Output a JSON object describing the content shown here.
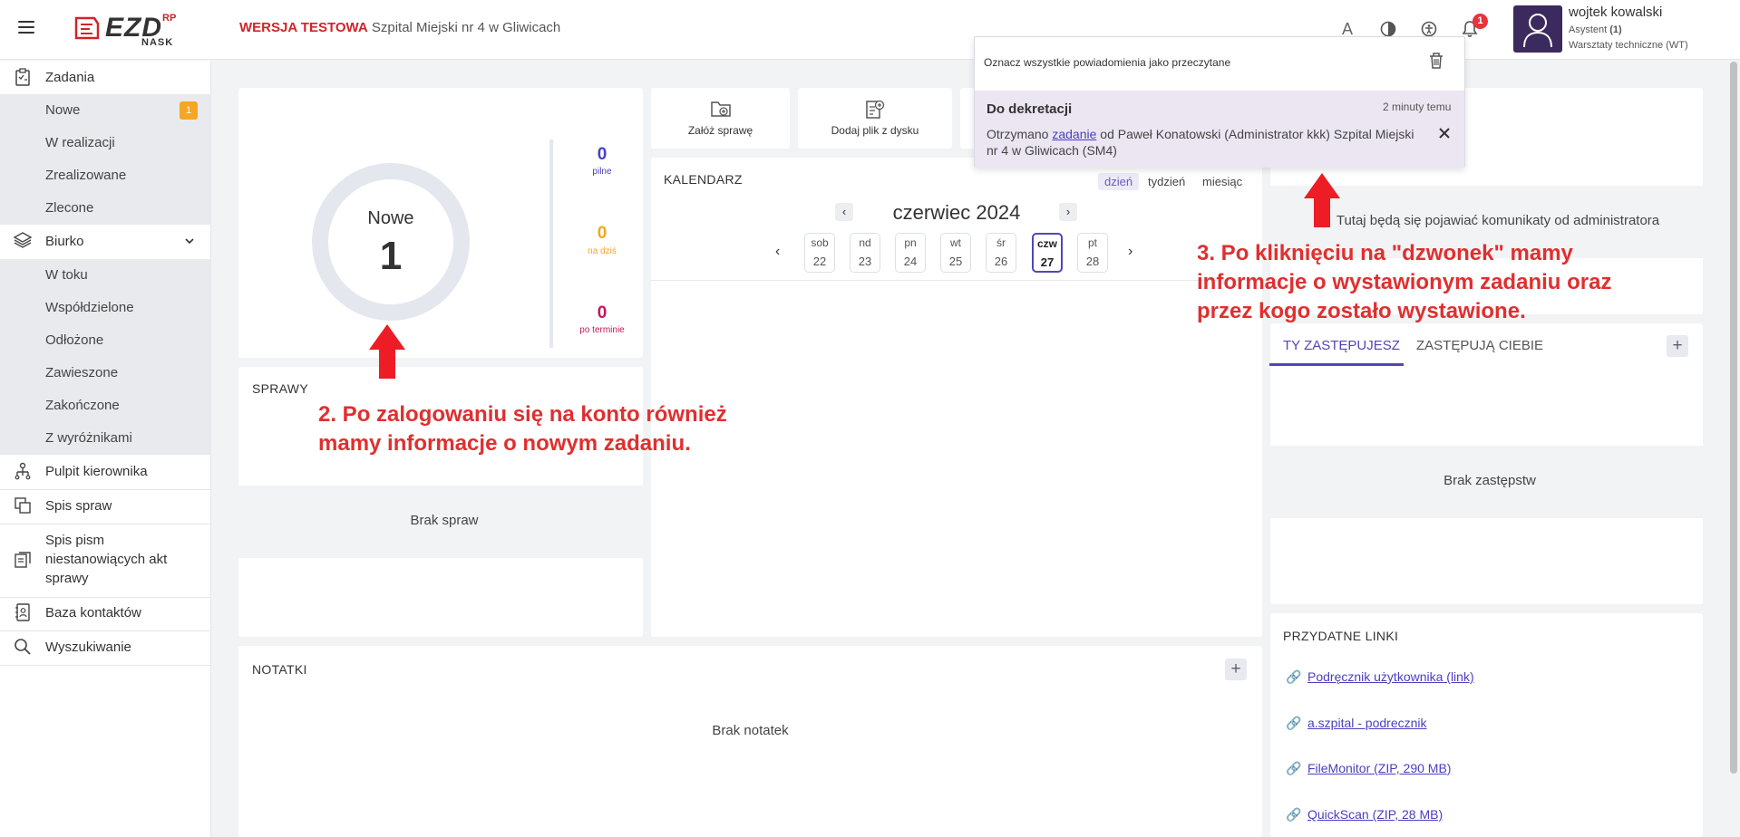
{
  "header": {
    "logo_text": "EZD",
    "logo_rp": "RP",
    "logo_nask": "NASK",
    "test_label": "WERSJA TESTOWA",
    "org_name": "Szpital Miejski nr 4 w Gliwicach",
    "notification_count": "1",
    "user": {
      "name": "wojtek kowalski",
      "role": "Asystent",
      "role_count": "(1)",
      "dept": "Warsztaty techniczne (WT)"
    },
    "icons": [
      "font-size-icon",
      "contrast-icon",
      "accessibility-icon",
      "bell-icon"
    ]
  },
  "sidebar": {
    "zadania": "Zadania",
    "zadania_items": [
      {
        "label": "Nowe",
        "badge": "1"
      },
      {
        "label": "W realizacji"
      },
      {
        "label": "Zrealizowane"
      },
      {
        "label": "Zlecone"
      }
    ],
    "biurko": "Biurko",
    "biurko_items": [
      {
        "label": "W toku"
      },
      {
        "label": "Współdzielone"
      },
      {
        "label": "Odłożone"
      },
      {
        "label": "Zawieszone"
      },
      {
        "label": "Zakończone"
      },
      {
        "label": "Z wyróżnikami"
      }
    ],
    "pulpit": "Pulpit kierownika",
    "spis_spraw": "Spis spraw",
    "spis_pism_1": "Spis pism",
    "spis_pism_2": "niestanowiących akt",
    "spis_pism_3": "sprawy",
    "baza": "Baza kontaktów",
    "wyszukiwanie": "Wyszukiwanie"
  },
  "tasks_widget": {
    "label": "Nowe",
    "count": "1",
    "pilne_count": "0",
    "pilne_label": "pilne",
    "dzis_count": "0",
    "dzis_label": "na dziś",
    "termin_count": "0",
    "termin_label": "po terminie",
    "colors": {
      "pilne": "#4a3fc2",
      "dzis": "#f5a623",
      "termin": "#c2185b"
    }
  },
  "quick_actions": {
    "zaloz": "Załóż sprawę",
    "dodaj": "Dodaj plik z dysku"
  },
  "calendar": {
    "title": "KALENDARZ",
    "views": [
      "dzień",
      "tydzień",
      "miesiąc"
    ],
    "active_view": "dzień",
    "month": "czerwiec 2024",
    "days": [
      {
        "name": "sob",
        "date": "22"
      },
      {
        "name": "nd",
        "date": "23"
      },
      {
        "name": "pn",
        "date": "24"
      },
      {
        "name": "wt",
        "date": "25"
      },
      {
        "name": "śr",
        "date": "26"
      },
      {
        "name": "czw",
        "date": "27",
        "today": true
      },
      {
        "name": "pt",
        "date": "28"
      }
    ]
  },
  "sprawy": {
    "title": "SPRAWY",
    "empty": "Brak spraw"
  },
  "notatki": {
    "title": "NOTATKI",
    "empty": "Brak notatek"
  },
  "admin": {
    "message": "Tutaj będą się pojawiać komunikaty od administratora"
  },
  "substitutes": {
    "tab_1": "TY ZASTĘPUJESZ",
    "tab_2": "ZASTĘPUJĄ CIEBIE",
    "empty": "Brak zastępstw"
  },
  "links": {
    "title": "PRZYDATNE LINKI",
    "items": [
      "Podręcznik użytkownika (link)",
      "a.szpital - podrecznik",
      "FileMonitor (ZIP, 290 MB)",
      "QuickScan (ZIP, 28 MB)"
    ]
  },
  "notification_panel": {
    "mark_all": "Oznacz wszystkie powiadomienia jako przeczytane",
    "item_title": "Do dekretacji",
    "item_time": "2 minuty temu",
    "item_text_1": "Otrzymano ",
    "item_link": "zadanie",
    "item_text_2": " od Paweł Konatowski (Administrator kkk) Szpital Miejski",
    "item_text_3": "nr 4 w Gliwicach (SM4)"
  },
  "annotations": {
    "note_2_line_1": "2. Po zalogowaniu się na konto również",
    "note_2_line_2": "mamy informacje o nowym zadaniu.",
    "note_3_line_1": "3. Po kliknięciu na \"dzwonek\" mamy",
    "note_3_line_2": "informacje o wystawionym zadaniu oraz",
    "note_3_line_3": "przez kogo zostało wystawione.",
    "color": "#e02f2f"
  }
}
